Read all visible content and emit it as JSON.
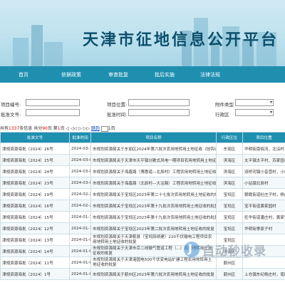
{
  "banner": {
    "title": "天津市征地信息公开平台"
  },
  "nav": {
    "items": [
      "首页",
      "依据政策",
      "审查批复",
      "批后实施",
      "法律法规"
    ]
  },
  "form": {
    "project_code_label": "项目编号:",
    "project_location_label": "项目位置:",
    "attachment_type_label": "附件类型",
    "approval_no_label": "批准文号:",
    "approval_time_label": "批准时间:",
    "district_label": "行政区",
    "attachment_type_value": "",
    "district_value": ""
  },
  "pager": {
    "prefix": "共有",
    "total": "1337",
    "mid1": "条信息 共分",
    "pages": "90",
    "mid2": "页 第",
    "current": "1",
    "mid3": "页",
    "arrows": "◁ ◁◁ ▷ ▷▷",
    "goto": "跳到",
    "goto_page": "1",
    "suffix": "页"
  },
  "table": {
    "headers": [
      "批准文号",
      "批准时间",
      "项目名称",
      "行政区位",
      "项目位置"
    ],
    "rows": [
      [
        "津规资源海批〔2024〕26号",
        "2024-03-15",
        "市规划资源局关于东丽区2024年第六批次农用地转用土地征收（挂钩试点）的批复",
        "东丽区",
        "华明街南临河、北沿村"
      ],
      [
        "津规资源海批〔2024〕25号",
        "2024-03-01",
        "市规划资源局关于天津市天平镇分散式风电一期项目农用地转用土地征收的批复",
        "滨海区",
        "太平镇太平村、苏家园村"
      ],
      [
        "津规资源海批〔2024〕24号",
        "2024-03-01",
        "市规划资源局关于海鑫路（博惠道—北辰村）工程农用地转用土地征收的批复",
        "滨海区",
        "双桥河镇小昔营村，小站镇"
      ],
      [
        "津规资源海批〔2024〕23号",
        "2024-03-01",
        "市规划资源局关于海鑫路（北辰村—大沽路）工程农用地转用土地征收的批复",
        "滨海区",
        "小站镇北辰村"
      ],
      [
        "津规资源海批〔2024〕19号",
        "2024-02-28",
        "市规划资源局关于宝坻区2023年第二十七批次农用地转用土地征收的批复",
        "宝坻区",
        "朝霞街道杜庄子村，杨庄村"
      ],
      [
        "津规资源海批〔2024〕16号",
        "2024-02-28",
        "市规划资源局关于宝坻区2023年第十九批次农用地转用土地征收的批复",
        "宝坻区",
        "宝平街道黄家园村"
      ],
      [
        "津规资源海批〔2024〕15号",
        "2024-01-18",
        "市规划资源局关于宝坻区2023年第十九批次农用地转用土地征收的批复",
        "宝坻区",
        "狂华街道潘庄村，黄家营村"
      ],
      [
        "津规资源海批〔2024〕12号",
        "2024-01-18",
        "市规划资源局关于宝坻区2023年第二批次农用地转用土地征收的批复",
        "宝坻区",
        "华明街季家子村"
      ],
      [
        "津规资源海批〔2024〕13号",
        "2024-01-09",
        "市规划资源局关于天津蓟县（宝坻段续建）220千伏输电工程项目农用地转用土地征收的批复",
        "宝坻区",
        ""
      ],
      [
        "津规资源海批〔2024〕14号",
        "2024-01-09",
        "市规划资源局关于天津市京二线输气管道工程（...）农用地转用土地征收的批复",
        "滨海区",
        ""
      ],
      [
        "津规资源海批〔2024〕11号",
        "2024-01-09",
        "市规划资源局关于天津港国电500千伏变电站扩建工程农用地转用土地征收的批复",
        "蓟州区",
        ""
      ],
      [
        "津规资源海批〔2024〕1号",
        "2024-01-04",
        "市规划资源局关于蓟州区2023年第六批次农用地转用土地征收的批复",
        "蓟州区",
        "上仓镇东纪杨庄村，南旺庄村"
      ]
    ]
  },
  "watermark": {
    "text": "自动秒收录",
    "sub": "ZIDONGMIAOSHOULU.COM",
    "logo_letter": "J"
  },
  "colors": {
    "nav": "#1f8fb0",
    "banner_title": "#0b4f6c",
    "total_red": "#d60000"
  }
}
